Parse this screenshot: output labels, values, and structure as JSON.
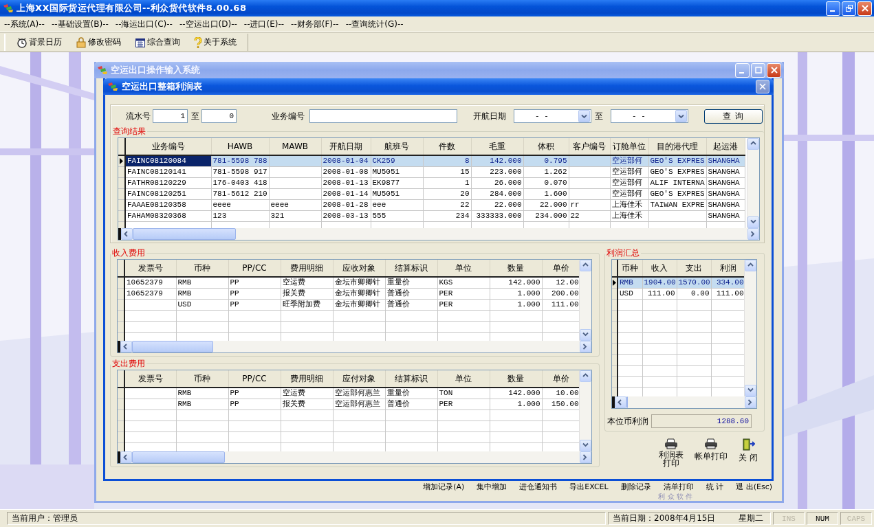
{
  "app": {
    "title": "上海XX国际货运代理有限公司--利众货代软件8.00.68"
  },
  "menu": [
    "--系统(A)--",
    "--基础设置(B)--",
    "--海运出口(C)--",
    "--空运出口(D)--",
    "--进口(E)--",
    "--财务部(F)--",
    "--查询统计(G)--"
  ],
  "toolbar": [
    "背景日历",
    "修改密码",
    "综合查询",
    "关于系统"
  ],
  "back_window": {
    "title": "空运出口操作输入系统",
    "buttons": [
      "增加记录(A)",
      "集中增加",
      "进仓通知书",
      "导出EXCEL",
      "删除记录",
      "清单打印",
      "统 计",
      "退 出(Esc)"
    ],
    "brand": "利 众 软 件"
  },
  "dialog": {
    "title": "空运出口整箱利润表",
    "filters": {
      "serial_label": "流水号",
      "serial_from": "1",
      "to_label": "至",
      "serial_to": "0",
      "business_label": "业务编号",
      "date_label": "开航日期",
      "date_from": "- -",
      "date_to_label": "至",
      "date_to": "- -",
      "query_button": "查 询"
    },
    "results": {
      "label": "查询结果",
      "columns": [
        "业务编号",
        "HAWB",
        "MAWB",
        "开航日期",
        "航班号",
        "件数",
        "毛重",
        "体积",
        "客户编号",
        "订舱单位",
        "目的港代理",
        "起运港"
      ],
      "rows": [
        {
          "selected": true,
          "cells": [
            "FAINC08120084",
            "781-5598 788",
            null,
            "2008-01-04",
            "CK259",
            "8",
            "142.000",
            "0.795",
            null,
            "空运部何",
            "GEO'S EXPRES",
            "SHANGHA"
          ]
        },
        {
          "selected": false,
          "cells": [
            "FAINC08120141",
            "781-5598 917",
            null,
            "2008-01-08",
            "MU5051",
            "15",
            "223.000",
            "1.262",
            null,
            "空运部何",
            "GEO'S EXPRES",
            "SHANGHA"
          ]
        },
        {
          "selected": false,
          "cells": [
            "FATHR08120229",
            "176-0403 418",
            null,
            "2008-01-13",
            "EK9877",
            "1",
            "26.000",
            "0.070",
            null,
            "空运部何",
            "ALIF INTERNA",
            "SHANGHA"
          ]
        },
        {
          "selected": false,
          "cells": [
            "FAINC08120251",
            "781-5612 210",
            null,
            "2008-01-14",
            "MU5051",
            "20",
            "284.000",
            "1.600",
            null,
            "空运部何",
            "GEO'S EXPRES",
            "SHANGHA"
          ]
        },
        {
          "selected": false,
          "cells": [
            "FAAAE08120358",
            "eeee",
            "eeee",
            "2008-01-28",
            "eee",
            "22",
            "22.000",
            "22.000",
            "rr",
            "上海佳禾",
            "TAIWAN EXPRE",
            "SHANGHA"
          ]
        },
        {
          "selected": false,
          "cells": [
            "FAHAM08320368",
            "123",
            "321",
            "2008-03-13",
            "555",
            "234",
            "333333.000",
            "234.000",
            "22",
            "上海佳禾",
            null,
            "SHANGHA"
          ]
        }
      ]
    },
    "income": {
      "label": "收入费用",
      "columns": [
        "发票号",
        "币种",
        "PP/CC",
        "费用明细",
        "应收对象",
        "结算标识",
        "单位",
        "数量",
        "单价"
      ],
      "rows": [
        {
          "selected": false,
          "cells": [
            "10652379",
            "RMB",
            "PP",
            "空运费",
            "金坛市卿卿针",
            "重量价",
            "KGS",
            "142.000",
            "12.00"
          ]
        },
        {
          "selected": false,
          "cells": [
            "10652379",
            "RMB",
            "PP",
            "报关费",
            "金坛市卿卿针",
            "普通价",
            "PER",
            "1.000",
            "200.00"
          ]
        },
        {
          "selected": false,
          "cells": [
            null,
            "USD",
            "PP",
            "旺季附加费",
            "金坛市卿卿针",
            "普通价",
            "PER",
            "1.000",
            "111.00"
          ]
        }
      ]
    },
    "expense": {
      "label": "支出费用",
      "columns": [
        "发票号",
        "币种",
        "PP/CC",
        "费用明细",
        "应付对象",
        "结算标识",
        "单位",
        "数量",
        "单价"
      ],
      "rows": [
        {
          "selected": false,
          "cells": [
            null,
            "RMB",
            "PP",
            "空运费",
            "空运部何惠兰",
            "重量价",
            "TON",
            "142.000",
            "10.00"
          ]
        },
        {
          "selected": false,
          "cells": [
            null,
            "RMB",
            "PP",
            "报关费",
            "空运部何惠兰",
            "普通价",
            "PER",
            "1.000",
            "150.00"
          ]
        }
      ]
    },
    "summary": {
      "label": "利润汇总",
      "columns": [
        "币种",
        "收入",
        "支出",
        "利润"
      ],
      "rows": [
        {
          "selected": true,
          "cells": [
            "RMB",
            "1904.00",
            "1570.00",
            "334.00"
          ]
        },
        {
          "selected": false,
          "cells": [
            "USD",
            "111.00",
            "0.00",
            "111.00"
          ]
        }
      ]
    },
    "base_profit": {
      "label": "本位币利润",
      "value": "1288.60"
    },
    "actions": [
      "利润表打印",
      "帐单打印",
      "关 闭"
    ]
  },
  "status_bar": {
    "user": "当前用户：管理员",
    "date": "当前日期：2008年4月15日",
    "weekday": "星期二",
    "keys": [
      {
        "label": "INS",
        "on": false
      },
      {
        "label": "NUM",
        "on": true
      },
      {
        "label": "CAPS",
        "on": false
      }
    ]
  }
}
